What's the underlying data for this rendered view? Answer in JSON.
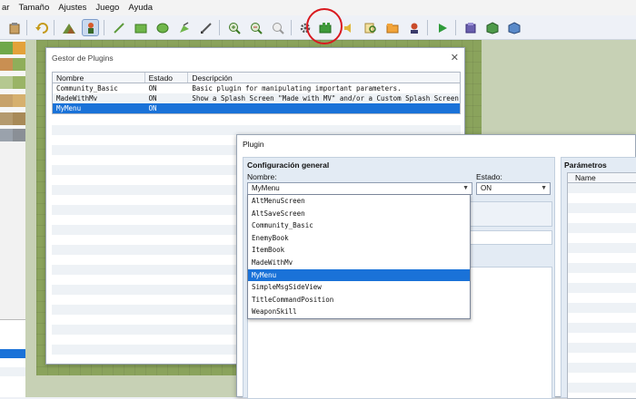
{
  "menubar": {
    "items": [
      "ar",
      "Tamaño",
      "Ajustes",
      "Juego",
      "Ayuda"
    ]
  },
  "toolbar": {
    "icons": [
      "paste-icon",
      "undo-icon",
      "map-layer-icon",
      "event-layer-icon",
      "pencil-icon",
      "rectangle-icon",
      "ellipse-icon",
      "fill-icon",
      "shadow-pen-icon",
      "zoom-in-icon",
      "zoom-out-icon",
      "zoom-actual-icon",
      "database-gear-icon",
      "plugin-manager-icon",
      "sound-test-icon",
      "event-search-icon",
      "resource-manager-icon",
      "character-generator-icon",
      "playtest-icon",
      "deploy-icon",
      "resource-3d-icon",
      "settings-box-icon"
    ],
    "highlight_color": "#d9191f"
  },
  "plugin_manager": {
    "title": "Gestor de Plugins",
    "columns": [
      "Nombre",
      "Estado",
      "Descripción"
    ],
    "rows": [
      {
        "name": "Community_Basic",
        "status": "ON",
        "description": "Basic plugin for manipulating important parameters."
      },
      {
        "name": "MadeWithMv",
        "status": "ON",
        "description": "Show a Splash Screen \"Made with MV\" and/or a Custom Splash Screen be…"
      },
      {
        "name": "MyMenu",
        "status": "ON",
        "description": ""
      }
    ],
    "selected_row": 2
  },
  "plugin_dialog": {
    "title": "Plugin",
    "general_title": "Configuración general",
    "name_label": "Nombre:",
    "name_value": "MyMenu",
    "status_label": "Estado:",
    "status_value": "ON",
    "params_title": "Parámetros",
    "params_column": "Name",
    "author_label_fragment": "A"
  },
  "dropdown": {
    "options": [
      "AltMenuScreen",
      "AltSaveScreen",
      "Community_Basic",
      "EnemyBook",
      "ItemBook",
      "MadeWithMv",
      "MyMenu",
      "SimpleMsgSideView",
      "TitleCommandPosition",
      "WeaponSkill"
    ],
    "selected": "MyMenu"
  },
  "colors": {
    "selection": "#1a72d8",
    "grass": "#8aa35c"
  }
}
